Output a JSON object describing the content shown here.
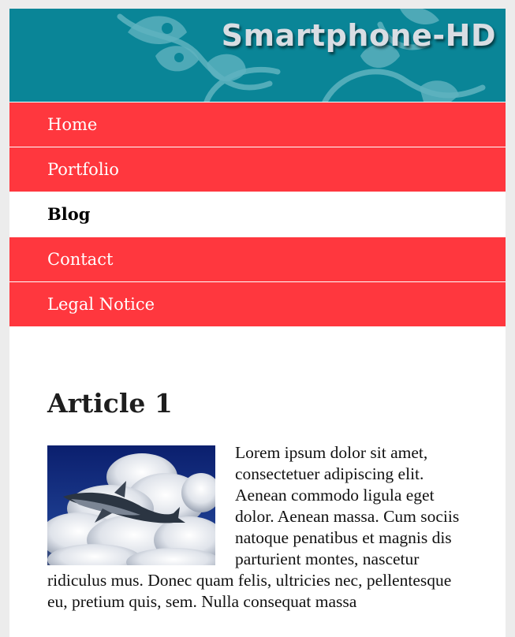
{
  "banner": {
    "title": "Smartphone-HD",
    "background_color": "#0a8597"
  },
  "nav": {
    "items": [
      {
        "label": "Home",
        "active": false
      },
      {
        "label": "Portfolio",
        "active": false
      },
      {
        "label": "Blog",
        "active": true
      },
      {
        "label": "Contact",
        "active": false
      },
      {
        "label": "Legal Notice",
        "active": false
      }
    ],
    "accent_color": "#ff373e"
  },
  "article": {
    "title": "Article 1",
    "image_subject": "whale-in-clouds-image",
    "body": "Lorem ipsum dolor sit amet, consectetuer adipiscing elit. Aenean commodo ligula eget dolor. Aenean massa. Cum sociis natoque penatibus et magnis dis parturient montes, nascetur ridiculus mus. Donec quam felis, ultricies nec, pellentesque eu, pretium quis, sem. Nulla consequat massa"
  }
}
